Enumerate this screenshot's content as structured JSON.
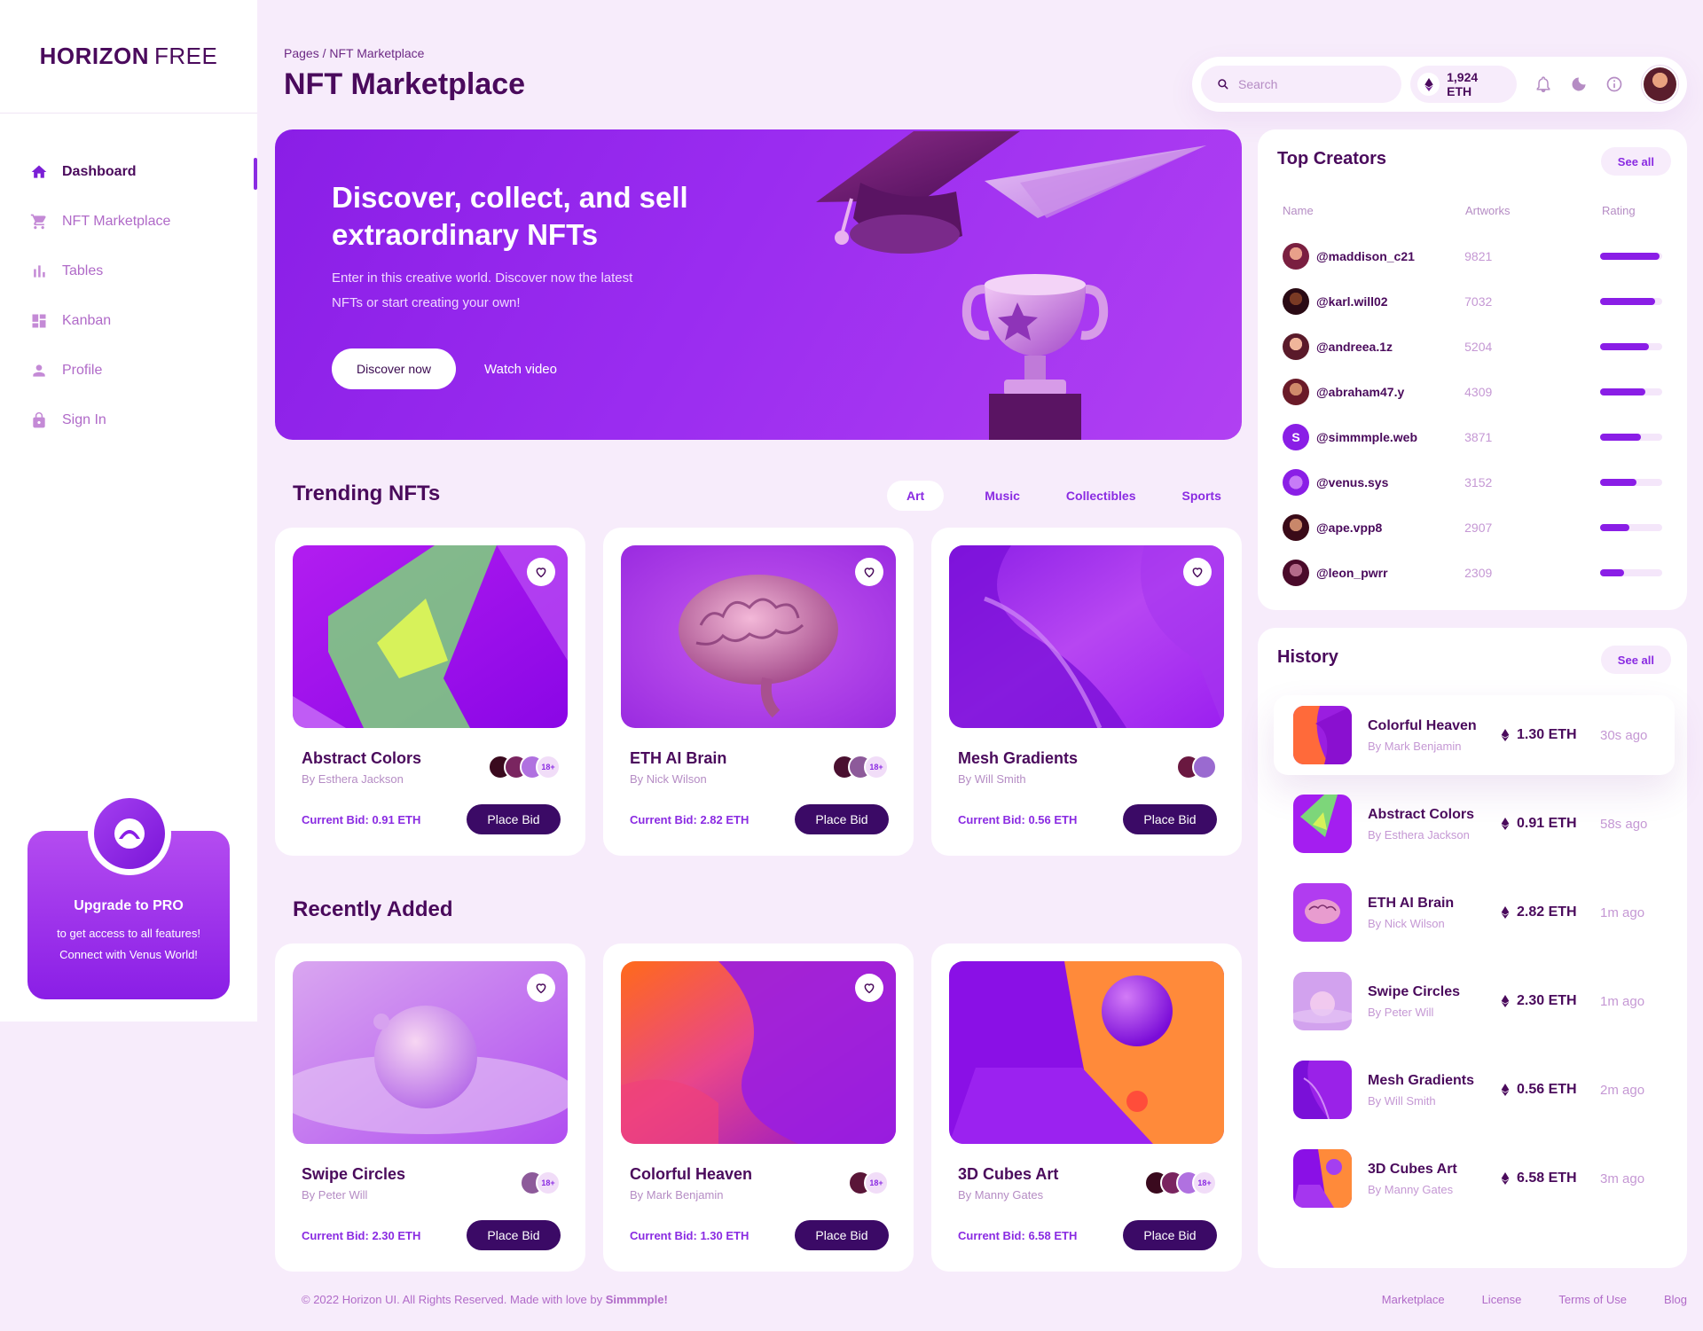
{
  "brand": {
    "bold": "HORIZON",
    "light": "FREE"
  },
  "sidebar": {
    "items": [
      {
        "label": "Dashboard",
        "icon": "home-icon",
        "active": true
      },
      {
        "label": "NFT Marketplace",
        "icon": "cart-icon",
        "active": false
      },
      {
        "label": "Tables",
        "icon": "bar-chart-icon",
        "active": false
      },
      {
        "label": "Kanban",
        "icon": "dashboard-grid-icon",
        "active": false
      },
      {
        "label": "Profile",
        "icon": "person-icon",
        "active": false
      },
      {
        "label": "Sign In",
        "icon": "lock-icon",
        "active": false
      }
    ],
    "upgrade": {
      "title": "Upgrade to PRO",
      "text": "to get access to all features! Connect with Venus World!"
    }
  },
  "header": {
    "breadcrumb": "Pages / NFT Marketplace",
    "title": "NFT Marketplace",
    "search_placeholder": "Search",
    "balance": "1,924 ETH"
  },
  "hero": {
    "title": "Discover, collect, and sell extraordinary NFTs",
    "text": "Enter in this creative world. Discover now the latest NFTs or start creating your own!",
    "primary_button": "Discover now",
    "secondary_button": "Watch video"
  },
  "trending": {
    "title": "Trending NFTs",
    "tabs": [
      "Art",
      "Music",
      "Collectibles",
      "Sports"
    ],
    "active_tab": "Art",
    "cards": [
      {
        "name": "Abstract Colors",
        "author": "By Esthera Jackson",
        "bid": "Current Bid: 0.91 ETH",
        "button": "Place Bid",
        "more": "18+"
      },
      {
        "name": "ETH AI Brain",
        "author": "By Nick Wilson",
        "bid": "Current Bid: 2.82 ETH",
        "button": "Place Bid",
        "more": "18+"
      },
      {
        "name": "Mesh Gradients",
        "author": "By Will Smith",
        "bid": "Current Bid: 0.56 ETH",
        "button": "Place Bid",
        "more": ""
      }
    ]
  },
  "recent": {
    "title": "Recently Added",
    "cards": [
      {
        "name": "Swipe Circles",
        "author": "By Peter Will",
        "bid": "Current Bid: 2.30 ETH",
        "button": "Place Bid",
        "more": "18+"
      },
      {
        "name": "Colorful Heaven",
        "author": "By Mark Benjamin",
        "bid": "Current Bid: 1.30 ETH",
        "button": "Place Bid",
        "more": "18+"
      },
      {
        "name": "3D Cubes Art",
        "author": "By Manny Gates",
        "bid": "Current Bid: 6.58 ETH",
        "button": "Place Bid",
        "more": "18+"
      }
    ]
  },
  "top_creators": {
    "title": "Top Creators",
    "see_all": "See all",
    "columns": [
      "Name",
      "Artworks",
      "Rating"
    ],
    "rows": [
      {
        "name": "@maddison_c21",
        "artworks": "9821",
        "rating": 0.95
      },
      {
        "name": "@karl.will02",
        "artworks": "7032",
        "rating": 0.88
      },
      {
        "name": "@andreea.1z",
        "artworks": "5204",
        "rating": 0.78
      },
      {
        "name": "@abraham47.y",
        "artworks": "4309",
        "rating": 0.72
      },
      {
        "name": "@simmmple.web",
        "artworks": "3871",
        "rating": 0.65
      },
      {
        "name": "@venus.sys",
        "artworks": "3152",
        "rating": 0.58
      },
      {
        "name": "@ape.vpp8",
        "artworks": "2907",
        "rating": 0.47
      },
      {
        "name": "@leon_pwrr",
        "artworks": "2309",
        "rating": 0.38
      }
    ]
  },
  "history": {
    "title": "History",
    "see_all": "See all",
    "rows": [
      {
        "name": "Colorful Heaven",
        "author": "By Mark Benjamin",
        "price": "1.30 ETH",
        "time": "30s ago"
      },
      {
        "name": "Abstract Colors",
        "author": "By Esthera Jackson",
        "price": "0.91 ETH",
        "time": "58s ago"
      },
      {
        "name": "ETH AI Brain",
        "author": "By Nick Wilson",
        "price": "2.82 ETH",
        "time": "1m ago"
      },
      {
        "name": "Swipe Circles",
        "author": "By Peter Will",
        "price": "2.30 ETH",
        "time": "1m ago"
      },
      {
        "name": "Mesh Gradients",
        "author": "By Will Smith",
        "price": "0.56 ETH",
        "time": "2m ago"
      },
      {
        "name": "3D Cubes Art",
        "author": "By Manny Gates",
        "price": "6.58 ETH",
        "time": "3m ago"
      }
    ]
  },
  "footer": {
    "copyright": "© 2022 Horizon UI. All Rights Reserved. Made with love by",
    "author": "Simmmple!",
    "links": [
      "Marketplace",
      "License",
      "Terms of Use",
      "Blog"
    ]
  },
  "colors": {
    "accent": "#8a2be2",
    "dark": "#4a0a5c",
    "button_dark": "#3b0a66",
    "background": "#f7ecfb"
  }
}
